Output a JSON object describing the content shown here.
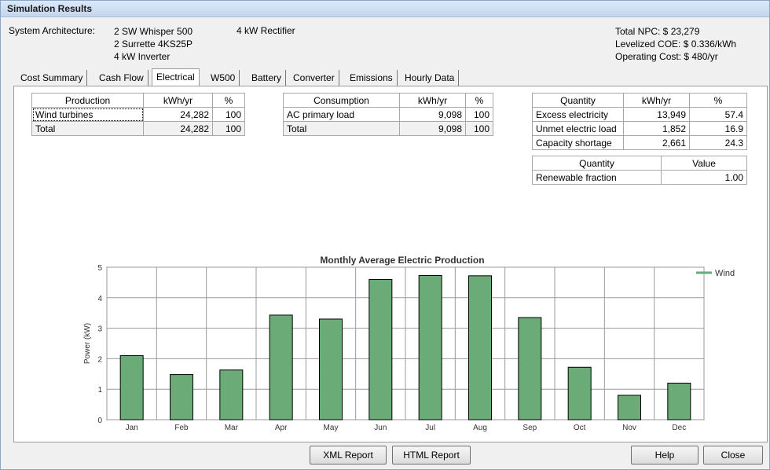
{
  "window": {
    "title": "Simulation Results"
  },
  "architecture": {
    "label": "System Architecture:",
    "col1": [
      "2 SW Whisper 500",
      "2 Surrette 4KS25P",
      "4 kW Inverter"
    ],
    "col2": [
      "4 kW Rectifier"
    ]
  },
  "summary": {
    "npc": "Total NPC:  $ 23,279",
    "coe": "Levelized COE:  $ 0.336/kWh",
    "opcost": "Operating Cost:  $ 480/yr"
  },
  "tabs": [
    "Cost Summary",
    "Cash Flow",
    "Electrical",
    "W500",
    "Battery",
    "Converter",
    "Emissions",
    "Hourly Data"
  ],
  "active_tab": "Electrical",
  "production": {
    "headers": [
      "Production",
      "kWh/yr",
      "%"
    ],
    "rows": [
      {
        "name": "Wind turbines",
        "kwh": "24,282",
        "pct": "100"
      },
      {
        "name": "Total",
        "kwh": "24,282",
        "pct": "100"
      }
    ]
  },
  "consumption": {
    "headers": [
      "Consumption",
      "kWh/yr",
      "%"
    ],
    "rows": [
      {
        "name": "AC primary load",
        "kwh": "9,098",
        "pct": "100"
      },
      {
        "name": "Total",
        "kwh": "9,098",
        "pct": "100"
      }
    ]
  },
  "quantity": {
    "headers": [
      "Quantity",
      "kWh/yr",
      "%"
    ],
    "rows": [
      {
        "name": "Excess electricity",
        "kwh": "13,949",
        "pct": "57.4"
      },
      {
        "name": "Unmet electric load",
        "kwh": "1,852",
        "pct": "16.9"
      },
      {
        "name": "Capacity shortage",
        "kwh": "2,661",
        "pct": "24.3"
      }
    ]
  },
  "renewable": {
    "headers": [
      "Quantity",
      "Value"
    ],
    "rows": [
      {
        "name": "Renewable fraction",
        "value": "1.00"
      }
    ]
  },
  "chart_data": {
    "type": "bar",
    "title": "Monthly Average Electric Production",
    "xlabel": "",
    "ylabel": "Power (kW)",
    "ylim": [
      0,
      5
    ],
    "yticks": [
      "0",
      "1",
      "2",
      "3",
      "4",
      "5"
    ],
    "categories": [
      "Jan",
      "Feb",
      "Mar",
      "Apr",
      "May",
      "Jun",
      "Jul",
      "Aug",
      "Sep",
      "Oct",
      "Nov",
      "Dec"
    ],
    "series": [
      {
        "name": "Wind",
        "values": [
          2.1,
          1.48,
          1.63,
          3.43,
          3.3,
          4.6,
          4.73,
          4.72,
          3.35,
          1.72,
          0.8,
          1.2
        ]
      }
    ],
    "legend": "top-right",
    "grid": true,
    "bar_color": "#6aab78"
  },
  "buttons": {
    "xml": "XML Report",
    "html": "HTML Report",
    "help": "Help",
    "close": "Close"
  }
}
